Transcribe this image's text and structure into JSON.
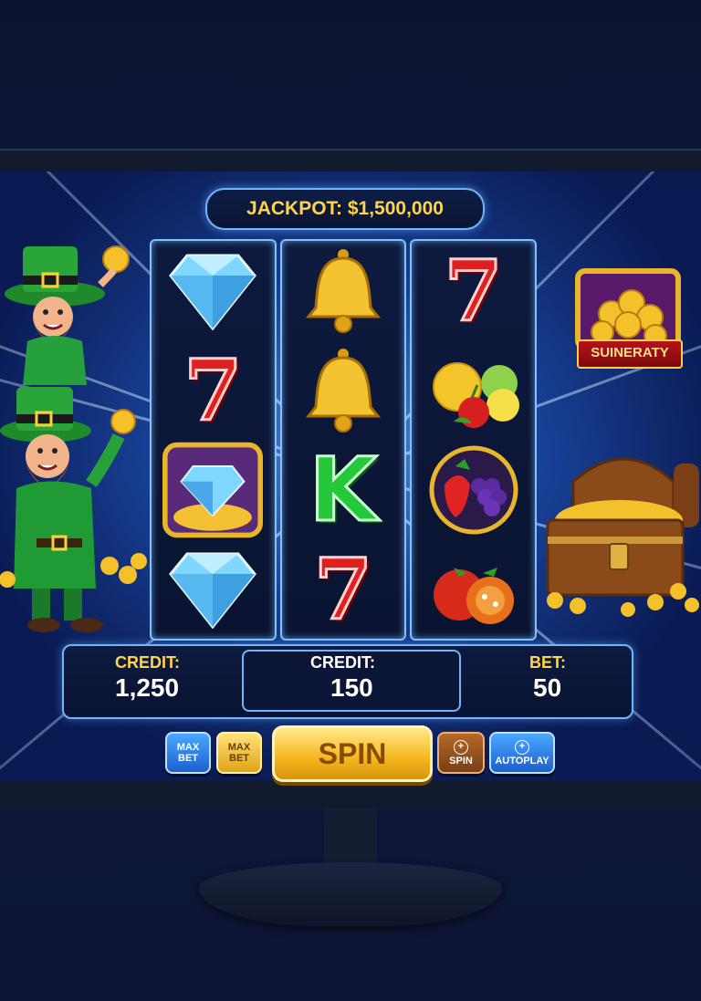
{
  "jackpot": {
    "label": "JACKPOT: $1,500,000"
  },
  "reels": [
    [
      "diamond",
      "seven",
      "diamond-gold-frame",
      "diamond"
    ],
    [
      "bell",
      "bell",
      "letter-k",
      "seven"
    ],
    [
      "seven",
      "citrus-fruits",
      "berry-fruits-ring",
      "tomato-fruits"
    ]
  ],
  "symbol_text": {
    "seven": "7",
    "letter_k": "K"
  },
  "status": {
    "credit_left": {
      "label": "CREDIT:",
      "value": "1,250"
    },
    "credit_mid": {
      "label": "CREDIT:",
      "value": "150"
    },
    "bet": {
      "label": "BET:",
      "value": "50"
    }
  },
  "buttons": {
    "max_bet_blue": "MAX BET",
    "max_bet_gold": "MAX BET",
    "spin_main": "SPIN",
    "spin_small": "SPIN",
    "autoplay": "AUTOPLAY"
  },
  "bonus_badge": {
    "label": "SUINERATY"
  },
  "colors": {
    "gold": "#ffd34a",
    "reel_border": "#7cc3ff",
    "bg": "#0b1330"
  }
}
